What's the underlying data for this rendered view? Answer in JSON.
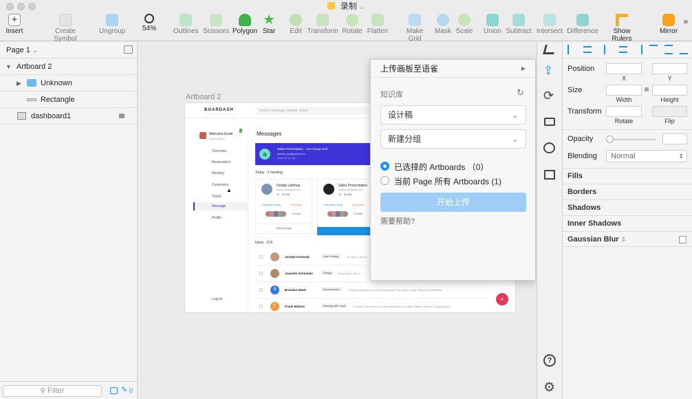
{
  "window": {
    "title": "录制"
  },
  "toolbar": {
    "items": [
      {
        "label": "Insert"
      },
      {
        "label": "Create Symbol"
      },
      {
        "label": "Ungroup"
      },
      {
        "label": "54%"
      },
      {
        "label": "Outlines"
      },
      {
        "label": "Scissors"
      },
      {
        "label": "Polygon"
      },
      {
        "label": "Star"
      },
      {
        "label": "Edit"
      },
      {
        "label": "Transform"
      },
      {
        "label": "Rotate"
      },
      {
        "label": "Flatten"
      },
      {
        "label": "Make Grid"
      },
      {
        "label": "Mask"
      },
      {
        "label": "Scale"
      },
      {
        "label": "Union"
      },
      {
        "label": "Subtract"
      },
      {
        "label": "Intersect"
      },
      {
        "label": "Difference"
      },
      {
        "label": "Show Rulers"
      },
      {
        "label": "Mirror"
      }
    ]
  },
  "layers": {
    "page": "Page 1",
    "items": [
      {
        "label": "Artboard 2"
      },
      {
        "label": "Unknown"
      },
      {
        "label": "Rectangle"
      },
      {
        "label": "dashboard1"
      }
    ],
    "filter_placeholder": "Filter",
    "filter_count": "0"
  },
  "canvas": {
    "artboard_label": "Artboard 2",
    "dashboard": {
      "brand": "BOARDASH",
      "search_placeholder": "Search message, people, ticket",
      "welcome": "Welcome Essie",
      "user_sub": "Essie Nelson",
      "nav": [
        "Overview",
        "Reservation",
        "Meeting",
        "Customers",
        "Ticket",
        "Message",
        "Profile"
      ],
      "logout": "Logout",
      "messages_title": "Messages",
      "banner_title": "Sales Presentation · Live Group Call",
      "banner_email": "adams_ka@gmail.com",
      "banner_sub": "Started 8 hrs ago",
      "today": "Today · 3 meeting",
      "card1_title": "Design catchup",
      "card1_email": "adams_ka@gmail.com",
      "card1_time": "11 · 30 AM",
      "card1_members": "9 Members Going",
      "card1_pending": "2 Pending",
      "card1_more": "+9 more",
      "card1_action": "View Details",
      "card2_title": "Sales Presentation",
      "card2_email": "adams_ka@gmail.com",
      "card2_time": "11 · 30 AM",
      "card2_members": "9 Members Going",
      "card2_pending": "8 Not pend",
      "card2_more": "+9 more",
      "inbox": "Inbox · 678",
      "inbox_rows": [
        {
          "name": "Joseph Kennedy",
          "tag": "User Testing",
          "msg": "Hi Jason, We ne",
          "initial": ""
        },
        {
          "name": "Jeanette Schneider",
          "tag": "Design",
          "msg": "Every week, We n",
          "initial": ""
        },
        {
          "name": "Brandon Mack",
          "tag": "Development",
          "msg": "Kaspara Upmann is now following you, You have a new follower on Dribbble...",
          "initial": "B"
        },
        {
          "name": "Frank Malone",
          "tag": "Meeting with Jack",
          "msg": "Hi Jason, We need to do user testing by monday, Please add me in slack group...",
          "initial": "F"
        }
      ]
    }
  },
  "popup": {
    "title": "上传画板至语雀",
    "section_label": "知识库",
    "select1": "设计稿",
    "select2": "新建分组",
    "radio1": "已选择的 Artboards （0）",
    "radio2": "当前 Page 所有 Artboards (1)",
    "upload_button": "开始上传",
    "help": "需要帮助?"
  },
  "inspector": {
    "position": "Position",
    "x": "X",
    "y": "Y",
    "size": "Size",
    "width": "Width",
    "height": "Height",
    "transform": "Transform",
    "rotate": "Rotate",
    "flip": "Flip",
    "opacity": "Opacity",
    "blending": "Blending",
    "blending_value": "Normal",
    "fills": "Fills",
    "borders": "Borders",
    "shadows": "Shadows",
    "inner_shadows": "Inner Shadows",
    "gaussian_blur": "Gaussian Blur"
  },
  "colors": {
    "accent_blue": "#1a90ff",
    "upload_btn": "#9fcdf5",
    "banner_blue": "#3d34d8",
    "star_green": "#4db84d",
    "union_teal": "#8cd6d2"
  }
}
